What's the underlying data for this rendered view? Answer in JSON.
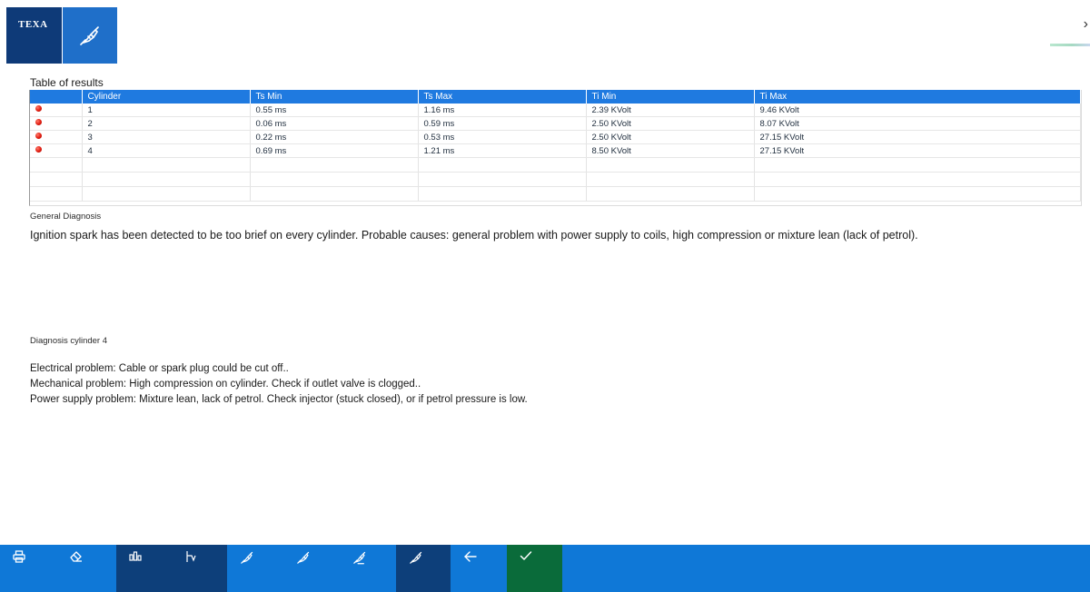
{
  "brand": {
    "logo_text": "TEXA"
  },
  "table": {
    "title": "Table of results",
    "columns": [
      "",
      "Cylinder",
      "Ts Min",
      "Ts Max",
      "Ti Min",
      "Ti Max"
    ],
    "rows": [
      {
        "cylinder": "1",
        "ts_min": "0.55 ms",
        "ts_max": "1.16 ms",
        "ti_min": "2.39 KVolt",
        "ti_max": "9.46 KVolt"
      },
      {
        "cylinder": "2",
        "ts_min": "0.06 ms",
        "ts_max": "0.59 ms",
        "ti_min": "2.50 KVolt",
        "ti_max": "8.07 KVolt"
      },
      {
        "cylinder": "3",
        "ts_min": "0.22 ms",
        "ts_max": "0.53 ms",
        "ti_min": "2.50 KVolt",
        "ti_max": "27.15 KVolt"
      },
      {
        "cylinder": "4",
        "ts_min": "0.69 ms",
        "ts_max": "1.21 ms",
        "ti_min": "8.50 KVolt",
        "ti_max": "27.15 KVolt"
      }
    ]
  },
  "general": {
    "label": "General Diagnosis",
    "text": "Ignition spark has been detected to be too brief on every cylinder. Probable causes: general problem with power supply to coils, high compression or mixture lean (lack of petrol)."
  },
  "cylinder_diag": {
    "label": "Diagnosis cylinder 4",
    "lines": [
      "Electrical problem: Cable or spark plug could be cut off..",
      "Mechanical problem: High compression on cylinder. Check if outlet valve is clogged..",
      "Power supply problem: Mixture lean, lack of petrol. Check injector (stuck closed), or if petrol pressure is low."
    ]
  },
  "colors": {
    "header_blue": "#1f7ae0",
    "toolbar_blue": "#0f78d7",
    "toolbar_dark": "#0d3f7a",
    "toolbar_green": "#0a6b3a",
    "status_red": "#e01b0f"
  },
  "toolbar": {
    "buttons": [
      "print-icon",
      "eraser-icon",
      "bar-chart-icon",
      "waveform-icon",
      "spark-plug-icon",
      "spark-plug-icon",
      "spark-plug-icon",
      "spark-plug-icon",
      "arrow-left-icon",
      "checkmark-icon"
    ]
  }
}
